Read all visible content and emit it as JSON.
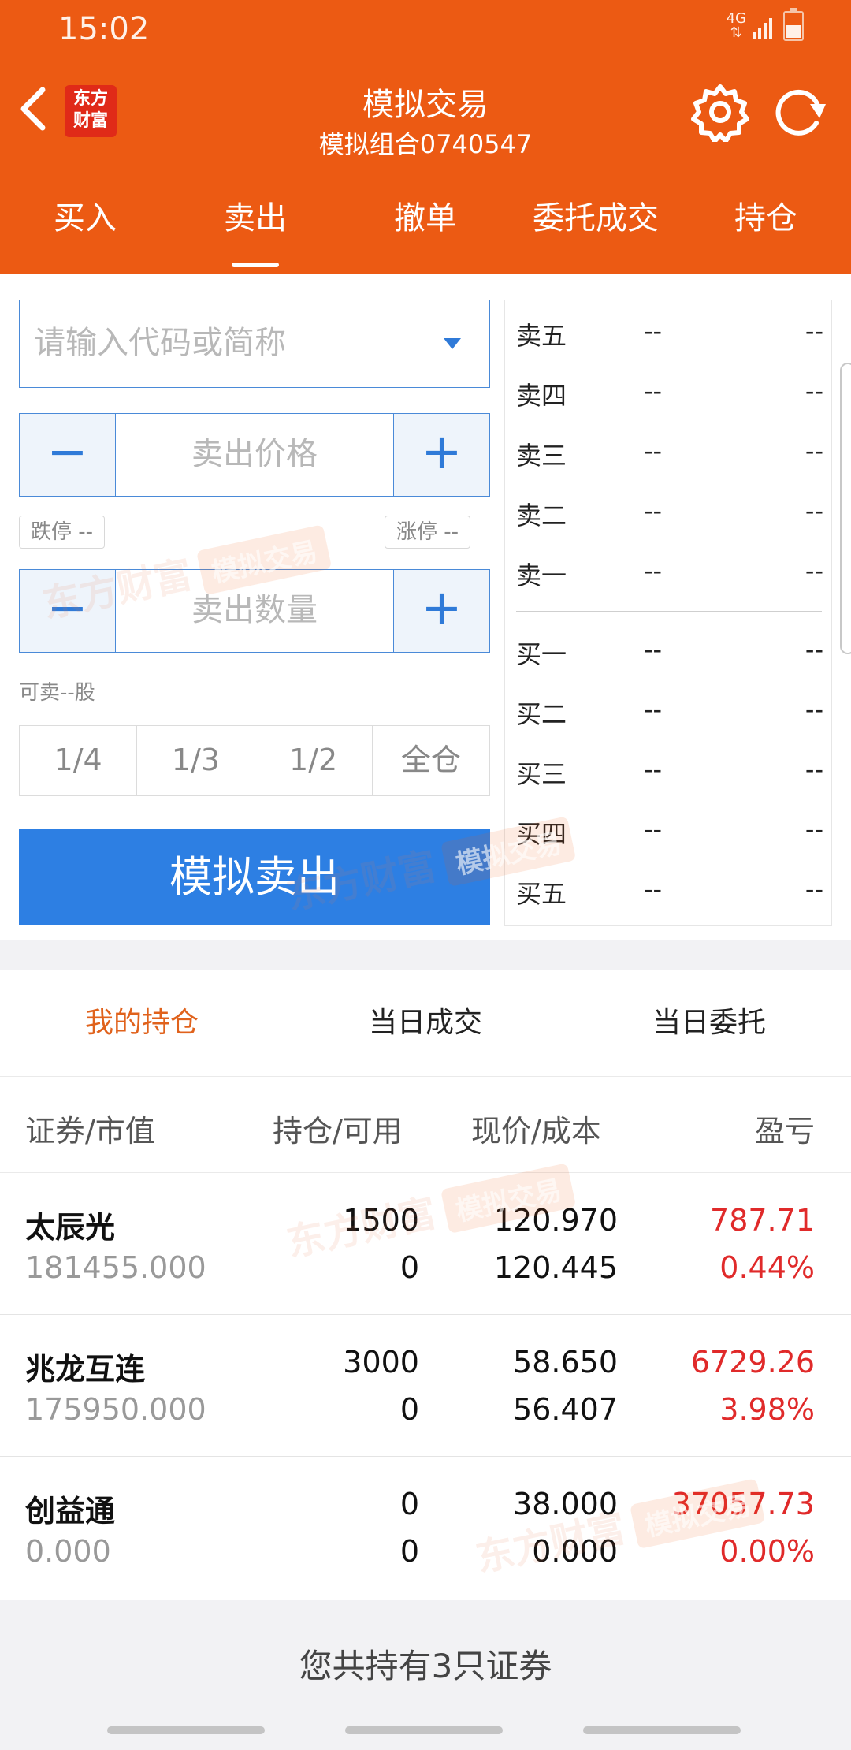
{
  "status": {
    "time": "15:02",
    "network": "4G"
  },
  "header": {
    "title": "模拟交易",
    "subtitle": "模拟组合0740547",
    "logo_text": "东方财富"
  },
  "tabs": [
    {
      "label": "买入"
    },
    {
      "label": "卖出"
    },
    {
      "label": "撤单"
    },
    {
      "label": "委托成交"
    },
    {
      "label": "持仓"
    }
  ],
  "form": {
    "code_placeholder": "请输入代码或简称",
    "minus": "−",
    "plus": "+",
    "price_placeholder": "卖出价格",
    "qty_placeholder": "卖出数量",
    "limit_down": "跌停 --",
    "limit_up": "涨停 --",
    "sellable": "可卖--股",
    "ratios": [
      "1/4",
      "1/3",
      "1/2",
      "全仓"
    ],
    "submit": "模拟卖出"
  },
  "order_book": {
    "asks": [
      {
        "label": "卖五",
        "price": "--",
        "vol": "--"
      },
      {
        "label": "卖四",
        "price": "--",
        "vol": "--"
      },
      {
        "label": "卖三",
        "price": "--",
        "vol": "--"
      },
      {
        "label": "卖二",
        "price": "--",
        "vol": "--"
      },
      {
        "label": "卖一",
        "price": "--",
        "vol": "--"
      }
    ],
    "bids": [
      {
        "label": "买一",
        "price": "--",
        "vol": "--"
      },
      {
        "label": "买二",
        "price": "--",
        "vol": "--"
      },
      {
        "label": "买三",
        "price": "--",
        "vol": "--"
      },
      {
        "label": "买四",
        "price": "--",
        "vol": "--"
      },
      {
        "label": "买五",
        "price": "--",
        "vol": "--"
      }
    ]
  },
  "subtabs": [
    {
      "label": "我的持仓"
    },
    {
      "label": "当日成交"
    },
    {
      "label": "当日委托"
    }
  ],
  "table": {
    "headers": [
      "证券/市值",
      "持仓/可用",
      "现价/成本",
      "盈亏"
    ],
    "rows": [
      {
        "name": "太辰光",
        "market_value": "181455.000",
        "qty": "1500",
        "avail": "0",
        "price": "120.970",
        "cost": "120.445",
        "pnl": "787.71",
        "pct": "0.44%"
      },
      {
        "name": "兆龙互连",
        "market_value": "175950.000",
        "qty": "3000",
        "avail": "0",
        "price": "58.650",
        "cost": "56.407",
        "pnl": "6729.26",
        "pct": "3.98%"
      },
      {
        "name": "创益通",
        "market_value": "0.000",
        "qty": "0",
        "avail": "0",
        "price": "38.000",
        "cost": "0.000",
        "pnl": "37057.73",
        "pct": "0.00%"
      }
    ]
  },
  "summary": "您共持有3只证券",
  "watermark": {
    "brand": "东方财富",
    "tag": "模拟交易"
  },
  "colors": {
    "header": "#ec5a13",
    "button": "#2d7fe3",
    "profit": "#e02a2a",
    "active_subtab": "#e0621c"
  }
}
